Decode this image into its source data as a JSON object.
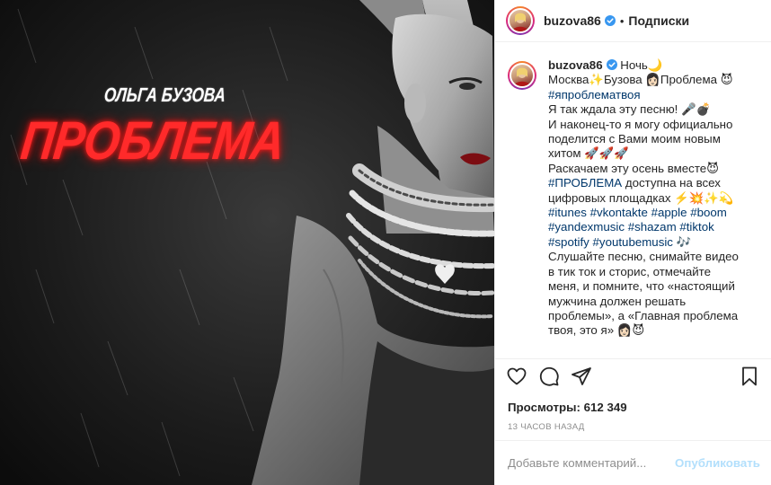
{
  "media": {
    "artist_name": "ОЛЬГА БУЗОВА",
    "song_title": "ПРОБЛЕМА",
    "title_color": "#ff2a2a"
  },
  "header": {
    "username": "buzova86",
    "verified_icon": "verified-badge-icon",
    "separator": "•",
    "follow_label": "Подписки"
  },
  "caption": {
    "username": "buzova86",
    "lines": [
      {
        "text": " Ночь🌙"
      },
      {
        "text": "Москва✨Бузова 👩🏻Проблема 😈"
      },
      {
        "text": "#япроблематвоя"
      },
      {
        "text": "Я так ждала эту песню! 🎤💣"
      },
      {
        "text": "И наконец-то я могу официально"
      },
      {
        "text": "поделится с Вами моим новым"
      },
      {
        "text": "хитом 🚀🚀🚀"
      },
      {
        "text": "Раскачаем эту осень вместе😈"
      },
      {
        "text": "#ПРОБЛЕМА доступна на всех"
      },
      {
        "text": "цифровых площадках ⚡️💥✨💫"
      },
      {
        "text": "#itunes #vkontakte #apple #boom"
      },
      {
        "text": "#yandexmusic #shazam #tiktok"
      },
      {
        "text": "#spotify #youtubemusic 🎶"
      },
      {
        "text": "Слушайте песню, снимайте видео"
      },
      {
        "text": "в тик ток и сторис, отмечайте"
      },
      {
        "text": "меня, и помните, что «настоящий"
      },
      {
        "text": "мужчина должен решать"
      },
      {
        "text": "проблемы», а «Главная проблема"
      },
      {
        "text": "твоя, это я» 👩🏻😈"
      }
    ]
  },
  "actions": {
    "like_icon": "heart-icon",
    "comment_icon": "comment-icon",
    "share_icon": "share-icon",
    "save_icon": "bookmark-icon"
  },
  "stats": {
    "views": "Просмотры: 612 349",
    "time_ago": "13 часов назад"
  },
  "comment": {
    "placeholder": "Добавьте комментарий...",
    "publish_label": "Опубликовать"
  },
  "colors": {
    "hashtag": "#00376b",
    "publish_disabled": "#b2dffc",
    "muted": "#8e8e8e",
    "verified": "#3897f0"
  }
}
